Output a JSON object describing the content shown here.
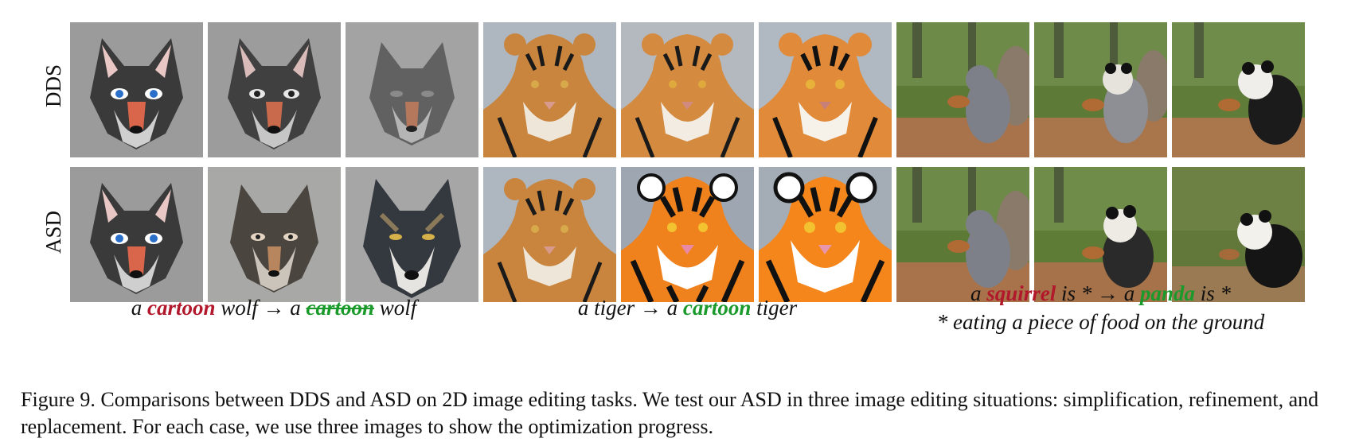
{
  "row_labels": {
    "top": "DDS",
    "bottom": "ASD"
  },
  "case_captions": {
    "wolf": {
      "p1": "a ",
      "w1": "cartoon",
      "p2": " wolf → a ",
      "w2": "cartoon",
      "p3": " wolf"
    },
    "tiger": {
      "p1": "a tiger → a ",
      "w1": "cartoon",
      "p2": " tiger"
    },
    "squirrel": {
      "p1": "a ",
      "w1": "squirrel",
      "p2": " is * → a ",
      "w2": "panda",
      "p3": " is *",
      "line2": "* eating a piece of food on the ground"
    }
  },
  "figure_caption": "Figure 9. Comparisons between DDS and ASD on 2D image editing tasks. We test our ASD in three image editing situations: simplification, refinement, and replacement. For each case, we use three images to show the optimization progress.",
  "colors": {
    "source_word": "#b2182b",
    "target_word": "#1a9a2a"
  }
}
